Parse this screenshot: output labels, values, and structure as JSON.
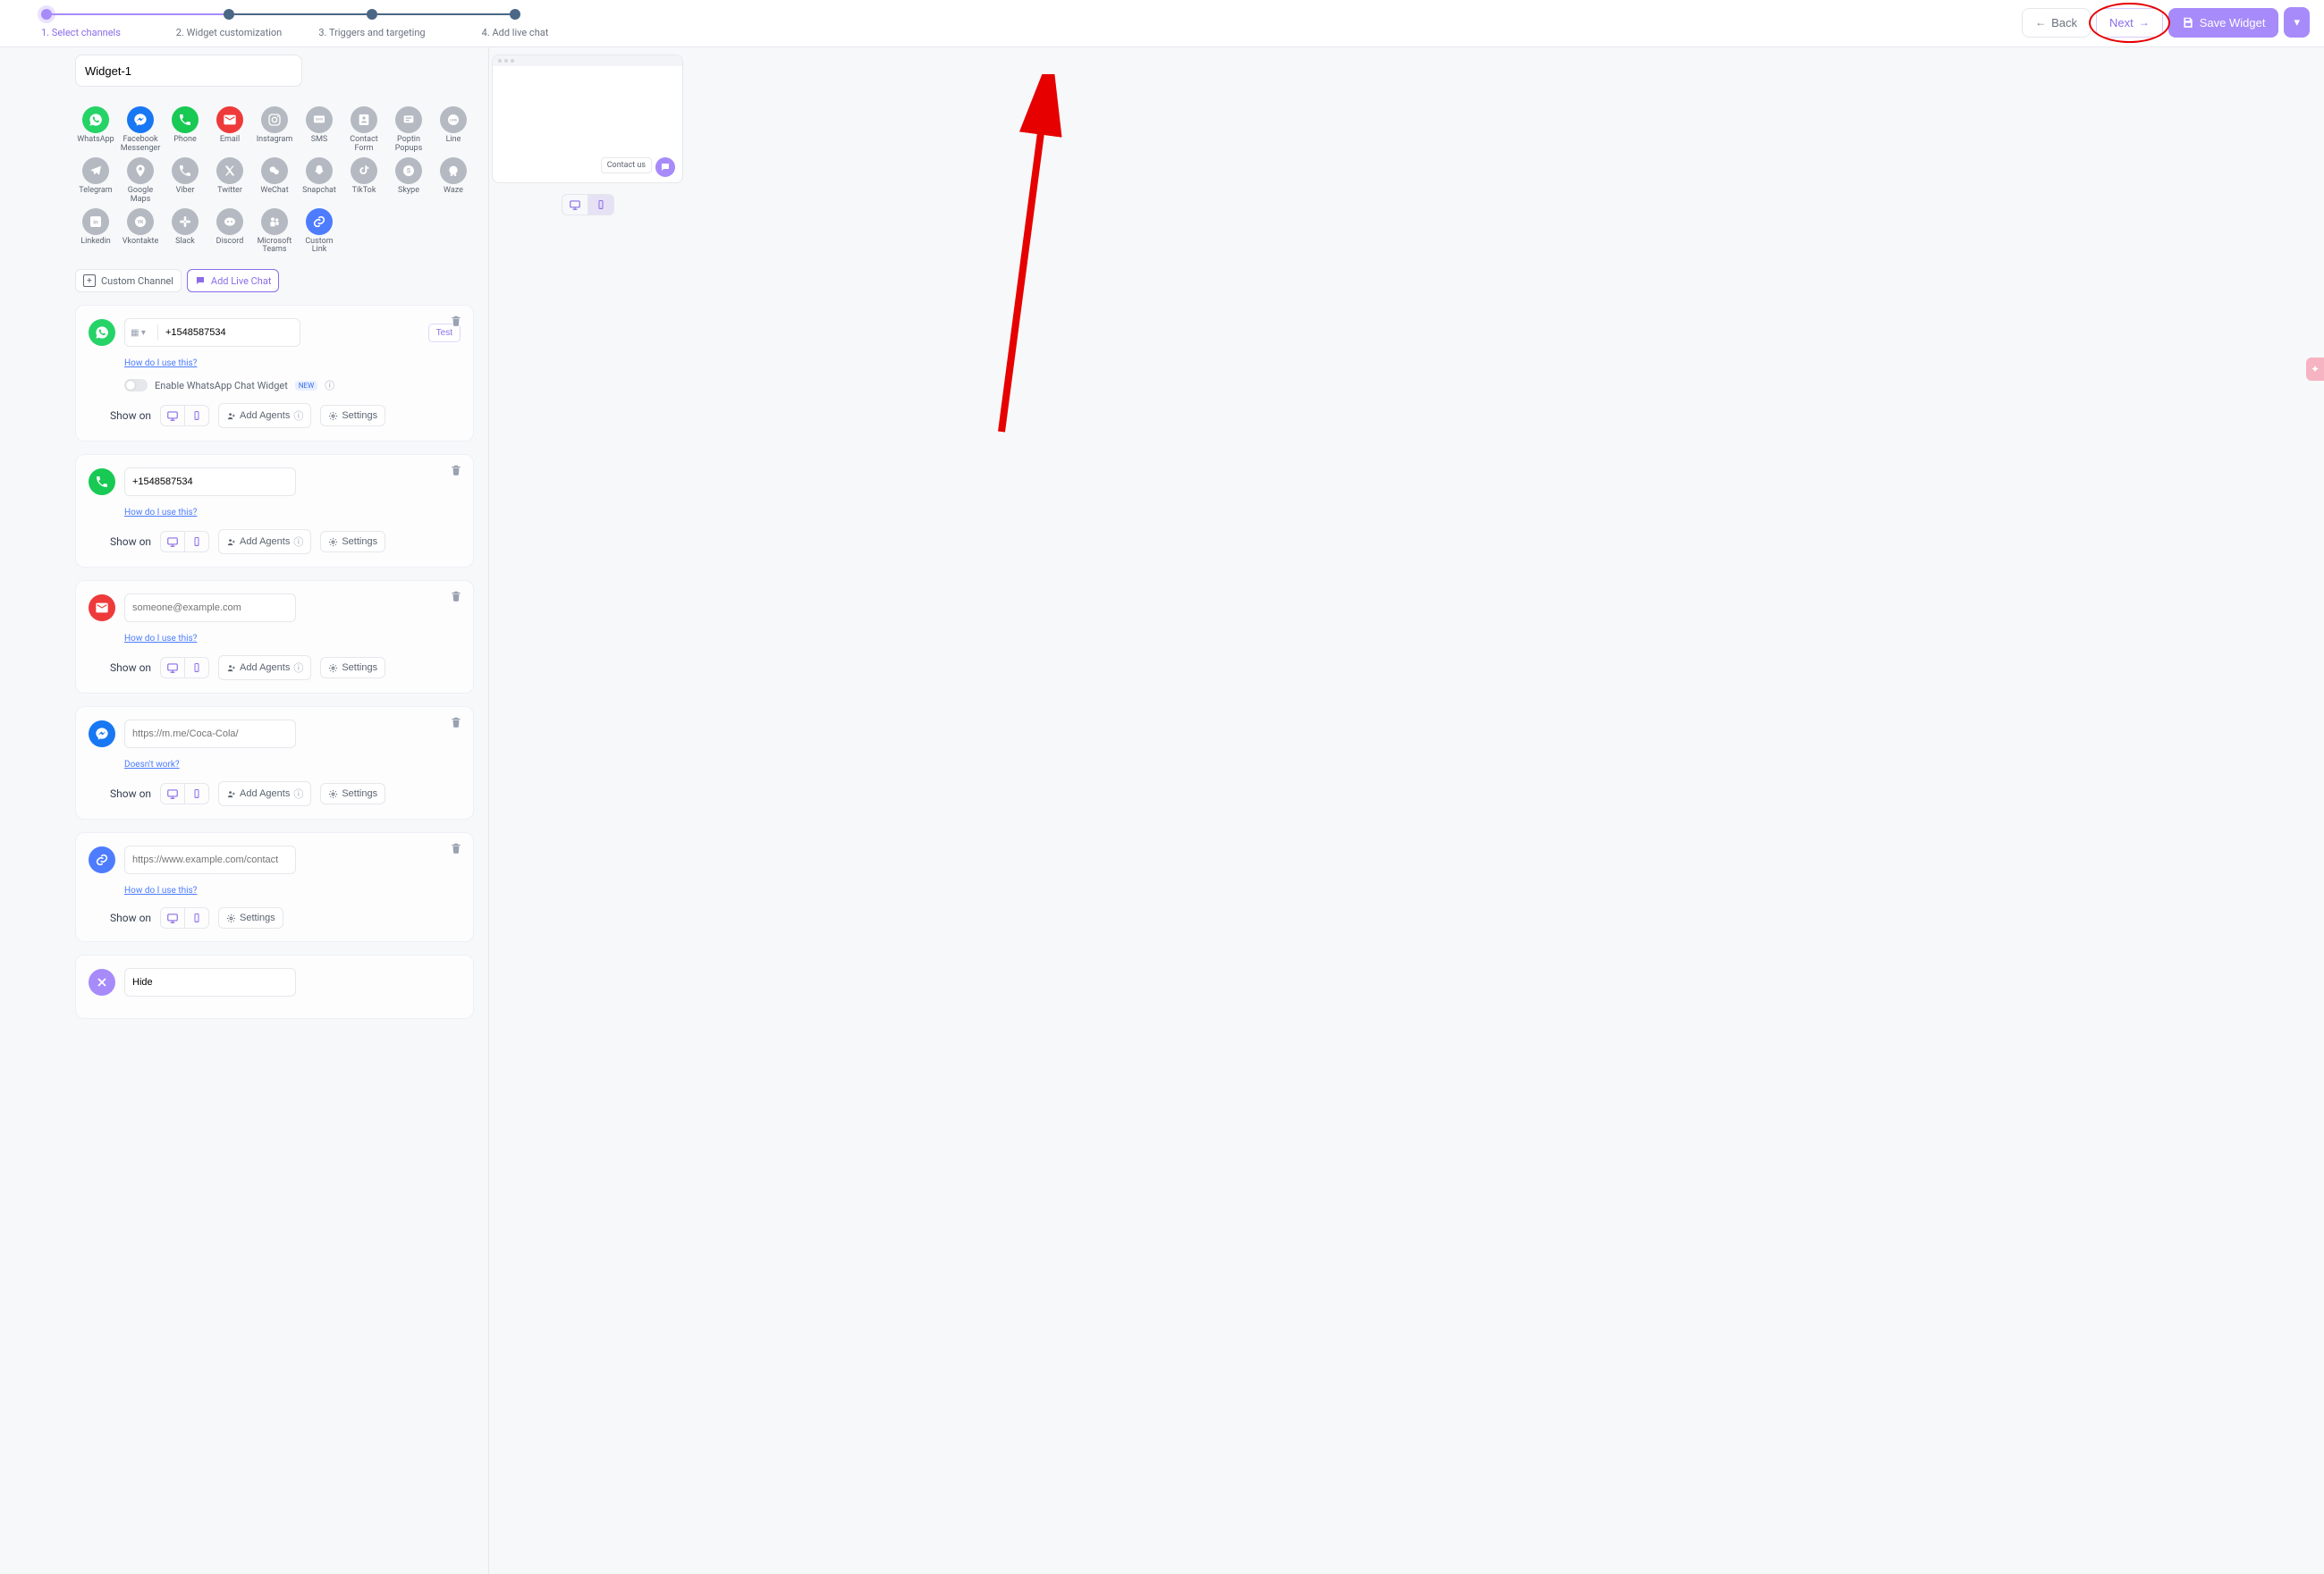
{
  "steps": [
    {
      "label": "1. Select channels",
      "state": "active"
    },
    {
      "label": "2. Widget customization",
      "state": "done"
    },
    {
      "label": "3. Triggers and targeting",
      "state": "done"
    },
    {
      "label": "4. Add live chat",
      "state": "done"
    }
  ],
  "header": {
    "back": "Back",
    "next": "Next",
    "save": "Save Widget"
  },
  "widget_name": "Widget-1",
  "channels": [
    {
      "id": "whatsapp",
      "label": "WhatsApp",
      "cls": "whatsapp",
      "svg": "whatsapp"
    },
    {
      "id": "messenger",
      "label": "Facebook Messenger",
      "cls": "messenger",
      "svg": "messenger"
    },
    {
      "id": "phone",
      "label": "Phone",
      "cls": "phone",
      "svg": "phone"
    },
    {
      "id": "email",
      "label": "Email",
      "cls": "email",
      "svg": "email"
    },
    {
      "id": "instagram",
      "label": "Instagram",
      "cls": "grey",
      "svg": "instagram"
    },
    {
      "id": "sms",
      "label": "SMS",
      "cls": "grey",
      "svg": "sms"
    },
    {
      "id": "contact",
      "label": "Contact Form",
      "cls": "grey",
      "svg": "contact"
    },
    {
      "id": "poptin",
      "label": "Poptin Popups",
      "cls": "grey",
      "svg": "poptin"
    },
    {
      "id": "line",
      "label": "Line",
      "cls": "grey",
      "svg": "line"
    },
    {
      "id": "telegram",
      "label": "Telegram",
      "cls": "grey",
      "svg": "telegram"
    },
    {
      "id": "gmaps",
      "label": "Google Maps",
      "cls": "grey",
      "svg": "pin"
    },
    {
      "id": "viber",
      "label": "Viber",
      "cls": "grey",
      "svg": "viber"
    },
    {
      "id": "twitter",
      "label": "Twitter",
      "cls": "grey",
      "svg": "twitter"
    },
    {
      "id": "wechat",
      "label": "WeChat",
      "cls": "grey",
      "svg": "wechat"
    },
    {
      "id": "snapchat",
      "label": "Snapchat",
      "cls": "grey",
      "svg": "snapchat"
    },
    {
      "id": "tiktok",
      "label": "TikTok",
      "cls": "grey",
      "svg": "tiktok"
    },
    {
      "id": "skype",
      "label": "Skype",
      "cls": "grey",
      "svg": "skype"
    },
    {
      "id": "waze",
      "label": "Waze",
      "cls": "grey",
      "svg": "waze"
    },
    {
      "id": "linkedin",
      "label": "Linkedin",
      "cls": "grey",
      "svg": "linkedin"
    },
    {
      "id": "vk",
      "label": "Vkontakte",
      "cls": "grey",
      "svg": "vk"
    },
    {
      "id": "slack",
      "label": "Slack",
      "cls": "grey",
      "svg": "slack"
    },
    {
      "id": "discord",
      "label": "Discord",
      "cls": "grey",
      "svg": "discord"
    },
    {
      "id": "teams",
      "label": "Microsoft Teams",
      "cls": "grey",
      "svg": "teams"
    },
    {
      "id": "custom",
      "label": "Custom Link",
      "cls": "customlink",
      "svg": "link"
    }
  ],
  "chips": {
    "custom": "Custom Channel",
    "live": "Add Live Chat"
  },
  "labels": {
    "how": "How do I use this?",
    "doesnt": "Doesn't work?",
    "enable_wa": "Enable WhatsApp Chat Widget",
    "show_on": "Show on",
    "add_agents": "Add Agents",
    "settings": "Settings",
    "test": "Test",
    "contact_us": "Contact us"
  },
  "cards": {
    "whatsapp": {
      "value": "+1548587534"
    },
    "phone": {
      "value": "+1548587534"
    },
    "email": {
      "placeholder": "someone@example.com"
    },
    "messenger": {
      "placeholder": "https://m.me/Coca-Cola/"
    },
    "customlink": {
      "placeholder": "https://www.example.com/contact"
    },
    "hide": {
      "value": "Hide"
    }
  }
}
